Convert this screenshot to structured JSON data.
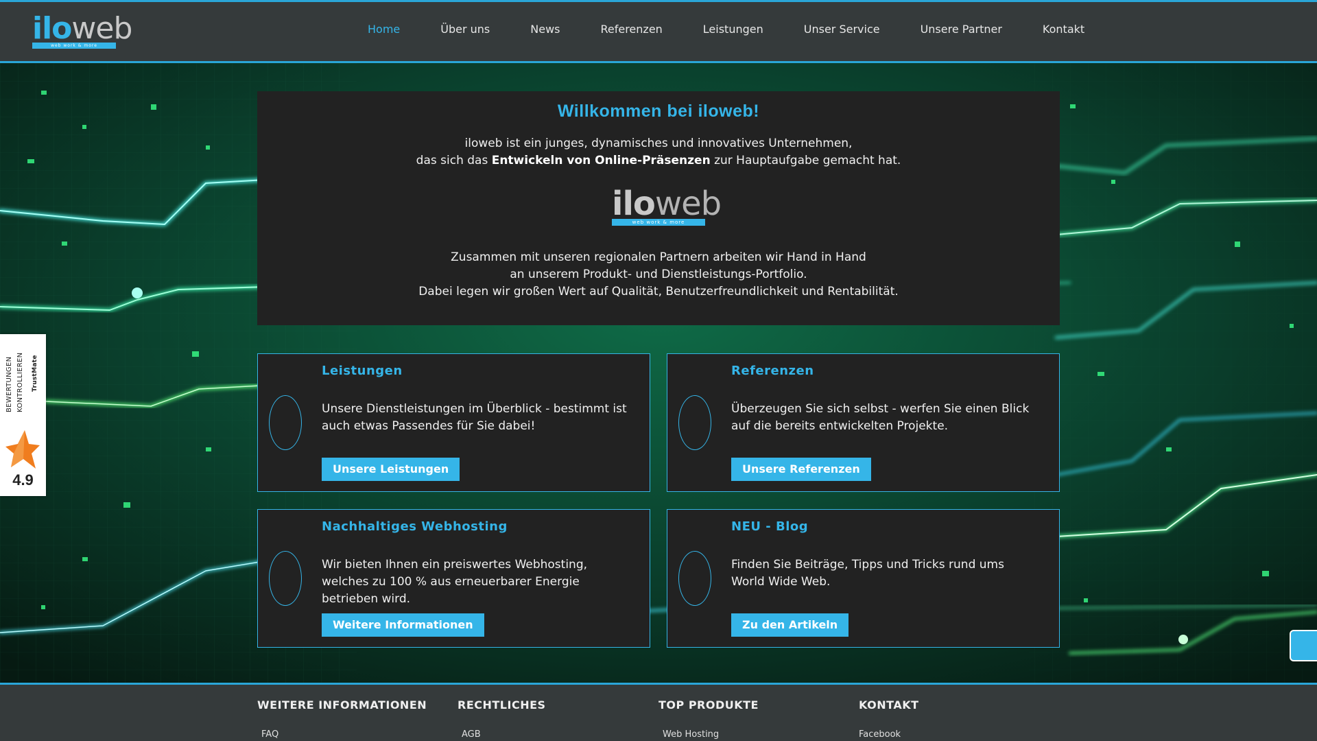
{
  "brand": {
    "logo_ilo": "ilo",
    "logo_web": "web",
    "logo_tagline": "web work & more"
  },
  "nav": {
    "items": [
      {
        "label": "Home",
        "active": true
      },
      {
        "label": "Über uns"
      },
      {
        "label": "News"
      },
      {
        "label": "Referenzen"
      },
      {
        "label": "Leistungen"
      },
      {
        "label": "Unser Service"
      },
      {
        "label": "Unsere Partner"
      },
      {
        "label": "Kontakt"
      }
    ]
  },
  "welcome": {
    "title": "Willkommen bei iloweb!",
    "line1": "iloweb ist ein junges, dynamisches und innovatives Unternehmen,",
    "line2_pre": "das sich das ",
    "line2_bold": "Entwickeln von Online-Präsenzen",
    "line2_post": " zur Hauptaufgabe gemacht hat.",
    "line3": "Zusammen mit unseren regionalen Partnern arbeiten wir Hand in Hand",
    "line4": "an unserem Produkt- und Dienstleistungs-Portfolio.",
    "line5": "Dabei legen wir großen Wert auf Qualität, Benutzerfreundlichkeit und Rentabilität."
  },
  "cards": [
    {
      "title": "Leistungen",
      "text": "Unsere Dienstleistungen im Überblick - bestimmt ist auch etwas Passendes für Sie dabei!",
      "button": "Unsere Leistungen"
    },
    {
      "title": "Referenzen",
      "text": "Überzeugen Sie sich selbst - werfen Sie einen Blick auf die bereits entwickelten Projekte.",
      "button": "Unsere Referenzen"
    },
    {
      "title": "Nachhaltiges Webhosting",
      "text": "Wir bieten Ihnen ein preiswertes Webhosting, welches zu 100 % aus erneuerbarer Energie betrieben wird.",
      "button": "Weitere Informationen"
    },
    {
      "title": "NEU - Blog",
      "text": "Finden Sie Beiträge, Tipps und Tricks rund ums World Wide Web.",
      "button": "Zu den Artikeln"
    }
  ],
  "trustmate": {
    "line1": "BEWERTUNGEN",
    "line2": "KONTROLLIEREN",
    "brand": "TrustMate",
    "score": "4.9",
    "star_color": "#f07d1e"
  },
  "footer": {
    "columns": [
      {
        "heading": "WEITERE INFORMATIONEN",
        "link": "FAQ"
      },
      {
        "heading": "RECHTLICHES",
        "link": "AGB"
      },
      {
        "heading": "TOP PRODUKTE",
        "link": "Web Hosting"
      },
      {
        "heading": "KONTAKT",
        "link": "Facebook"
      }
    ]
  },
  "colors": {
    "accent": "#35b5e8",
    "header_bg": "#353a3b",
    "panel_bg": "#222222"
  }
}
